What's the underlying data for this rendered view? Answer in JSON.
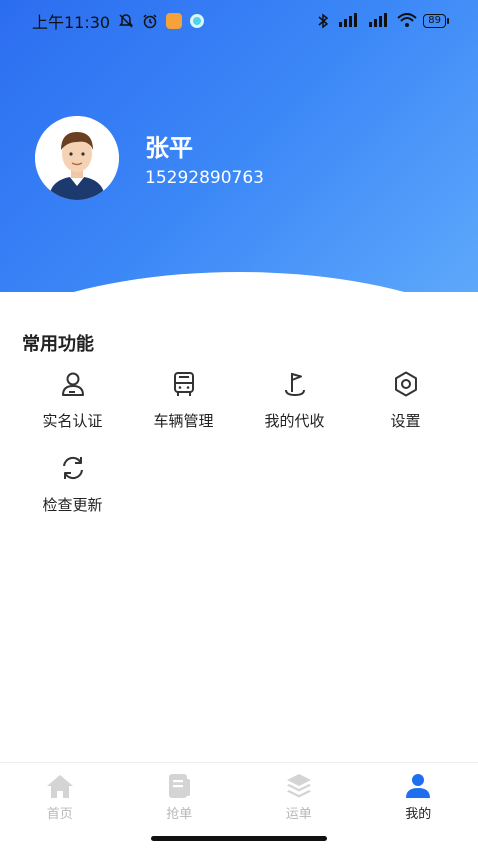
{
  "status_bar": {
    "time": "上午11:30",
    "battery": "89"
  },
  "profile": {
    "name": "张平",
    "phone": "15292890763"
  },
  "functions": {
    "title": "常用功能",
    "items": [
      {
        "label": "实名认证",
        "icon": "user-verify-icon"
      },
      {
        "label": "车辆管理",
        "icon": "bus-icon"
      },
      {
        "label": "我的代收",
        "icon": "flag-icon"
      },
      {
        "label": "设置",
        "icon": "gear-icon"
      },
      {
        "label": "检查更新",
        "icon": "refresh-icon"
      }
    ]
  },
  "nav": {
    "items": [
      {
        "label": "首页",
        "icon": "home-icon"
      },
      {
        "label": "抢单",
        "icon": "document-icon"
      },
      {
        "label": "运单",
        "icon": "layers-icon"
      },
      {
        "label": "我的",
        "icon": "person-icon",
        "active": true
      }
    ]
  },
  "colors": {
    "accent": "#2c6df0",
    "active_nav": "#1e6ff0",
    "inactive_nav": "#d4d4d4"
  }
}
